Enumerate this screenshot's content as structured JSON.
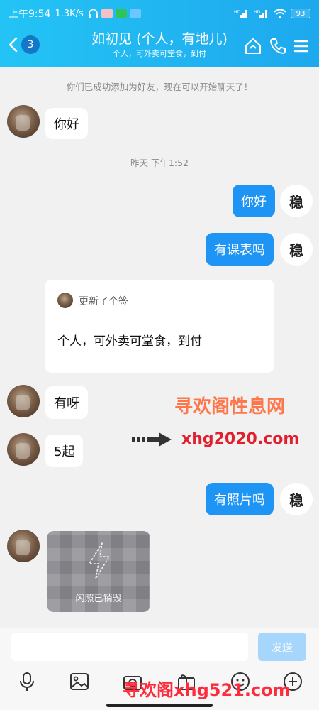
{
  "status_bar": {
    "time": "上午9:54",
    "speed": "1.3K/s",
    "battery": "93"
  },
  "header": {
    "back_badge": "3",
    "title": "如初见 (个人，有地儿)",
    "subtitle": "个人，可外卖可堂食，到付",
    "icons": [
      "back-chevron-icon",
      "home-icon",
      "phone-icon",
      "menu-icon"
    ]
  },
  "messages": {
    "friend_notice": "你们已成功添加为好友，现在可以开始聊天了！",
    "m1": "你好",
    "timestamp": "昨天 下午1:52",
    "m2": "你好",
    "my_avatar_text": "稳",
    "m3": "有课表吗",
    "signature_card": {
      "header": "更新了个签",
      "body": "个人，可外卖可堂食，到付"
    },
    "m4": "有呀",
    "m5": "5起",
    "m6": "有照片吗",
    "flash_photo_label": "闪照已销毁"
  },
  "watermarks": {
    "w1": "寻欢阁性息网",
    "w2": "xhg2020.com",
    "w3": "寻欢阁xhg521.com"
  },
  "input_bar": {
    "placeholder": "",
    "send_label": "发送",
    "tools": [
      "mic-icon",
      "image-icon",
      "camera-icon",
      "gift-icon",
      "emoji-icon",
      "plus-icon"
    ]
  },
  "colors": {
    "header_gradient_start": "#23c4f5",
    "header_gradient_end": "#1ea8ee",
    "my_bubble": "#1e94f5",
    "send_button_disabled": "#a6d6fb",
    "background": "#f1f1f1"
  }
}
